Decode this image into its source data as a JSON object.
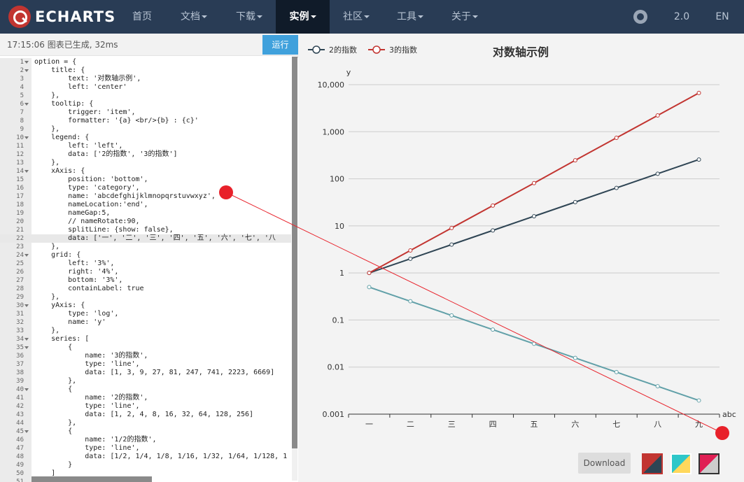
{
  "nav": {
    "logo_text": "ECHARTS",
    "items": [
      {
        "label": "首页",
        "dropdown": false
      },
      {
        "label": "文档",
        "dropdown": true
      },
      {
        "label": "下载",
        "dropdown": true
      },
      {
        "label": "实例",
        "dropdown": true,
        "active": true
      },
      {
        "label": "社区",
        "dropdown": true
      },
      {
        "label": "工具",
        "dropdown": true
      },
      {
        "label": "关于",
        "dropdown": true
      }
    ],
    "version_label": "2.0",
    "lang_label": "EN"
  },
  "editor": {
    "status": "17:15:06   图表已生成, 32ms",
    "run_label": "运行",
    "current_line": 22,
    "lines": [
      {
        "n": "1",
        "fold": true,
        "text": "option = {"
      },
      {
        "n": "2",
        "fold": true,
        "text": "    title: {"
      },
      {
        "n": "3",
        "fold": false,
        "text": "        text: '对数轴示例',"
      },
      {
        "n": "4",
        "fold": false,
        "text": "        left: 'center'"
      },
      {
        "n": "5",
        "fold": false,
        "text": "    },"
      },
      {
        "n": "6",
        "fold": true,
        "text": "    tooltip: {"
      },
      {
        "n": "7",
        "fold": false,
        "text": "        trigger: 'item',"
      },
      {
        "n": "8",
        "fold": false,
        "text": "        formatter: '{a} <br/>{b} : {c}'"
      },
      {
        "n": "9",
        "fold": false,
        "text": "    },"
      },
      {
        "n": "10",
        "fold": true,
        "text": "    legend: {"
      },
      {
        "n": "11",
        "fold": false,
        "text": "        left: 'left',"
      },
      {
        "n": "12",
        "fold": false,
        "text": "        data: ['2的指数', '3的指数']"
      },
      {
        "n": "13",
        "fold": false,
        "text": "    },"
      },
      {
        "n": "14",
        "fold": true,
        "text": "    xAxis: {"
      },
      {
        "n": "15",
        "fold": false,
        "text": "        position: 'bottom',"
      },
      {
        "n": "16",
        "fold": false,
        "text": "        type: 'category',"
      },
      {
        "n": "17",
        "fold": false,
        "text": "        name: 'abcdefghijklmnopqrstuvwxyz',"
      },
      {
        "n": "18",
        "fold": false,
        "text": "        nameLocation:'end',"
      },
      {
        "n": "19",
        "fold": false,
        "text": "        nameGap:5,"
      },
      {
        "n": "20",
        "fold": false,
        "text": "        // nameRotate:90,"
      },
      {
        "n": "21",
        "fold": false,
        "text": "        splitLine: {show: false},"
      },
      {
        "n": "22",
        "fold": false,
        "text": "        data: ['一', '二', '三', '四', '五', '六', '七', '八"
      },
      {
        "n": "23",
        "fold": false,
        "text": "    },"
      },
      {
        "n": "24",
        "fold": true,
        "text": "    grid: {"
      },
      {
        "n": "25",
        "fold": false,
        "text": "        left: '3%',"
      },
      {
        "n": "26",
        "fold": false,
        "text": "        right: '4%',"
      },
      {
        "n": "27",
        "fold": false,
        "text": "        bottom: '3%',"
      },
      {
        "n": "28",
        "fold": false,
        "text": "        containLabel: true"
      },
      {
        "n": "29",
        "fold": false,
        "text": "    },"
      },
      {
        "n": "30",
        "fold": true,
        "text": "    yAxis: {"
      },
      {
        "n": "31",
        "fold": false,
        "text": "        type: 'log',"
      },
      {
        "n": "32",
        "fold": false,
        "text": "        name: 'y'"
      },
      {
        "n": "33",
        "fold": false,
        "text": "    },"
      },
      {
        "n": "34",
        "fold": true,
        "text": "    series: ["
      },
      {
        "n": "35",
        "fold": true,
        "text": "        {"
      },
      {
        "n": "36",
        "fold": false,
        "text": "            name: '3的指数',"
      },
      {
        "n": "37",
        "fold": false,
        "text": "            type: 'line',"
      },
      {
        "n": "38",
        "fold": false,
        "text": "            data: [1, 3, 9, 27, 81, 247, 741, 2223, 6669]"
      },
      {
        "n": "39",
        "fold": false,
        "text": "        },"
      },
      {
        "n": "40",
        "fold": true,
        "text": "        {"
      },
      {
        "n": "41",
        "fold": false,
        "text": "            name: '2的指数',"
      },
      {
        "n": "42",
        "fold": false,
        "text": "            type: 'line',"
      },
      {
        "n": "43",
        "fold": false,
        "text": "            data: [1, 2, 4, 8, 16, 32, 64, 128, 256]"
      },
      {
        "n": "44",
        "fold": false,
        "text": "        },"
      },
      {
        "n": "45",
        "fold": true,
        "text": "        {"
      },
      {
        "n": "46",
        "fold": false,
        "text": "            name: '1/2的指数',"
      },
      {
        "n": "47",
        "fold": false,
        "text": "            type: 'line',"
      },
      {
        "n": "48",
        "fold": false,
        "text": "            data: [1/2, 1/4, 1/8, 1/16, 1/32, 1/64, 1/128, 1"
      },
      {
        "n": "49",
        "fold": false,
        "text": "        }"
      },
      {
        "n": "50",
        "fold": false,
        "text": "    ]"
      },
      {
        "n": "51",
        "fold": false,
        "text": "};"
      }
    ]
  },
  "chart_data": {
    "type": "line",
    "title": "对数轴示例",
    "xlabel": "abc",
    "ylabel": "y",
    "y_scale": "log",
    "ylim": [
      0.001,
      10000
    ],
    "y_ticks": [
      "0.001",
      "0.01",
      "0.1",
      "1",
      "10",
      "100",
      "1,000",
      "10,000"
    ],
    "grid": true,
    "legend_position": "top-left",
    "categories": [
      "一",
      "二",
      "三",
      "四",
      "五",
      "六",
      "七",
      "八",
      "九"
    ],
    "series": [
      {
        "name": "3的指数",
        "in_legend": true,
        "color": "#c23531",
        "values": [
          1,
          3,
          9,
          27,
          81,
          247,
          741,
          2223,
          6669
        ]
      },
      {
        "name": "2的指数",
        "in_legend": true,
        "color": "#2f4554",
        "values": [
          1,
          2,
          4,
          8,
          16,
          32,
          64,
          128,
          256
        ]
      },
      {
        "name": "",
        "in_legend": false,
        "color": "#61a0a8",
        "values": [
          0.5,
          0.25,
          0.125,
          0.0625,
          0.03125,
          0.015625,
          0.0078125,
          0.00390625,
          0.001953125
        ]
      }
    ]
  },
  "actions": {
    "download_label": "Download"
  },
  "colors": {
    "nav_bg": "#293c55",
    "accent_red": "#c23531",
    "run_button": "#40a1dc",
    "annotation_red": "#e8212a"
  }
}
